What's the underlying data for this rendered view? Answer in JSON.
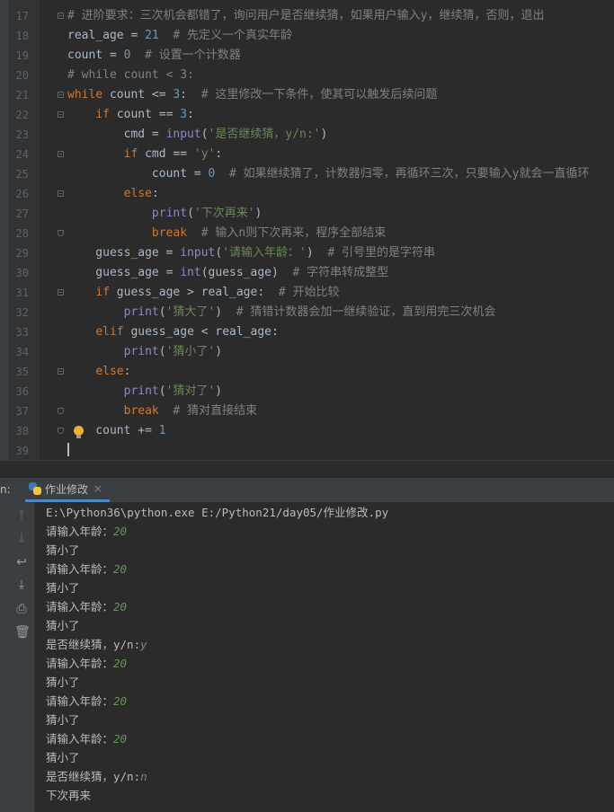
{
  "editor": {
    "lines": [
      {
        "n": "17",
        "fold": "open",
        "tokens": [
          {
            "t": "# 进阶要求：三次机会都错了，询问用户是否继续猜，如果用户输入y，继续猜，否则，退出",
            "c": "cm"
          }
        ]
      },
      {
        "n": "18",
        "tokens": [
          {
            "t": "real_age = "
          },
          {
            "t": "21",
            "c": "num"
          },
          {
            "t": "  "
          },
          {
            "t": "# 先定义一个真实年龄",
            "c": "cm"
          }
        ]
      },
      {
        "n": "19",
        "tokens": [
          {
            "t": "count = "
          },
          {
            "t": "0",
            "c": "num"
          },
          {
            "t": "  "
          },
          {
            "t": "# 设置一个计数器",
            "c": "cm"
          }
        ]
      },
      {
        "n": "20",
        "tokens": [
          {
            "t": "# while count < 3:",
            "c": "cm"
          }
        ]
      },
      {
        "n": "21",
        "fold": "open",
        "tokens": [
          {
            "t": "while",
            "c": "kw"
          },
          {
            "t": " count <= "
          },
          {
            "t": "3",
            "c": "num"
          },
          {
            "t": ":  "
          },
          {
            "t": "# 这里修改一下条件，使其可以触发后续问题",
            "c": "cm"
          }
        ]
      },
      {
        "n": "22",
        "fold": "open",
        "tokens": [
          {
            "t": "    "
          },
          {
            "t": "if",
            "c": "kw"
          },
          {
            "t": " count == "
          },
          {
            "t": "3",
            "c": "num"
          },
          {
            "t": ":"
          }
        ]
      },
      {
        "n": "23",
        "tokens": [
          {
            "t": "        cmd = "
          },
          {
            "t": "input",
            "c": "bi"
          },
          {
            "t": "("
          },
          {
            "t": "'是否继续猜，y/n:'",
            "c": "str"
          },
          {
            "t": ")"
          }
        ]
      },
      {
        "n": "24",
        "fold": "open",
        "tokens": [
          {
            "t": "        "
          },
          {
            "t": "if",
            "c": "kw"
          },
          {
            "t": " cmd == "
          },
          {
            "t": "'y'",
            "c": "str"
          },
          {
            "t": ":"
          }
        ]
      },
      {
        "n": "25",
        "tokens": [
          {
            "t": "            count = "
          },
          {
            "t": "0",
            "c": "num"
          },
          {
            "t": "  "
          },
          {
            "t": "# 如果继续猜了，计数器归零，再循环三次，只要输入y就会一直循环",
            "c": "cm"
          }
        ]
      },
      {
        "n": "26",
        "fold": "open",
        "tokens": [
          {
            "t": "        "
          },
          {
            "t": "else",
            "c": "kw"
          },
          {
            "t": ":"
          }
        ]
      },
      {
        "n": "27",
        "tokens": [
          {
            "t": "            "
          },
          {
            "t": "print",
            "c": "bi"
          },
          {
            "t": "("
          },
          {
            "t": "'下次再来'",
            "c": "str"
          },
          {
            "t": ")"
          }
        ]
      },
      {
        "n": "28",
        "fold": "end",
        "tokens": [
          {
            "t": "            "
          },
          {
            "t": "break",
            "c": "kw"
          },
          {
            "t": "  "
          },
          {
            "t": "# 输入n则下次再来，程序全部结束",
            "c": "cm"
          }
        ]
      },
      {
        "n": "29",
        "tokens": [
          {
            "t": "    guess_age = "
          },
          {
            "t": "input",
            "c": "bi"
          },
          {
            "t": "("
          },
          {
            "t": "'请输入年龄：'",
            "c": "str"
          },
          {
            "t": ")  "
          },
          {
            "t": "# 引号里的是字符串",
            "c": "cm"
          }
        ]
      },
      {
        "n": "30",
        "tokens": [
          {
            "t": "    guess_age = "
          },
          {
            "t": "int",
            "c": "bi"
          },
          {
            "t": "(guess_age)  "
          },
          {
            "t": "# 字符串转成整型",
            "c": "cm"
          }
        ]
      },
      {
        "n": "31",
        "fold": "open",
        "tokens": [
          {
            "t": "    "
          },
          {
            "t": "if",
            "c": "kw"
          },
          {
            "t": " guess_age > real_age:  "
          },
          {
            "t": "# 开始比较",
            "c": "cm"
          }
        ]
      },
      {
        "n": "32",
        "tokens": [
          {
            "t": "        "
          },
          {
            "t": "print",
            "c": "bi"
          },
          {
            "t": "("
          },
          {
            "t": "'猜大了'",
            "c": "str"
          },
          {
            "t": ")  "
          },
          {
            "t": "# 猜错计数器会加一继续验证，直到用完三次机会",
            "c": "cm"
          }
        ]
      },
      {
        "n": "33",
        "tokens": [
          {
            "t": "    "
          },
          {
            "t": "elif",
            "c": "kw"
          },
          {
            "t": " guess_age < real_age:"
          }
        ]
      },
      {
        "n": "34",
        "tokens": [
          {
            "t": "        "
          },
          {
            "t": "print",
            "c": "bi"
          },
          {
            "t": "("
          },
          {
            "t": "'猜小了'",
            "c": "str"
          },
          {
            "t": ")"
          }
        ]
      },
      {
        "n": "35",
        "fold": "open",
        "tokens": [
          {
            "t": "    "
          },
          {
            "t": "else",
            "c": "kw"
          },
          {
            "t": ":"
          }
        ]
      },
      {
        "n": "36",
        "tokens": [
          {
            "t": "        "
          },
          {
            "t": "print",
            "c": "bi"
          },
          {
            "t": "("
          },
          {
            "t": "'猜对了'",
            "c": "str"
          },
          {
            "t": ")"
          }
        ]
      },
      {
        "n": "37",
        "fold": "end",
        "tokens": [
          {
            "t": "        "
          },
          {
            "t": "break",
            "c": "kw"
          },
          {
            "t": "  "
          },
          {
            "t": "# 猜对直接结束",
            "c": "cm"
          }
        ]
      },
      {
        "n": "38",
        "fold": "end",
        "tokens": [
          {
            "t": "    count += "
          },
          {
            "t": "1",
            "c": "num"
          }
        ]
      },
      {
        "n": "39",
        "tokens": []
      }
    ]
  },
  "run": {
    "label": "n:",
    "tab_label": "作业修改",
    "close": "×"
  },
  "console": {
    "lines": [
      {
        "text": "E:\\Python36\\python.exe E:/Python21/day05/作业修改.py"
      },
      {
        "text": "请输入年龄：",
        "input": "20"
      },
      {
        "text": "猜小了"
      },
      {
        "text": "请输入年龄：",
        "input": "20"
      },
      {
        "text": "猜小了"
      },
      {
        "text": "请输入年龄：",
        "input": "20"
      },
      {
        "text": "猜小了"
      },
      {
        "text": "是否继续猜，y/n:",
        "input": "y"
      },
      {
        "text": "请输入年龄：",
        "input": "20"
      },
      {
        "text": "猜小了"
      },
      {
        "text": "请输入年龄：",
        "input": "20"
      },
      {
        "text": "猜小了"
      },
      {
        "text": "请输入年龄：",
        "input": "20"
      },
      {
        "text": "猜小了"
      },
      {
        "text": "是否继续猜，y/n:",
        "input": "n"
      },
      {
        "text": "下次再来"
      }
    ]
  },
  "toolbar": {
    "icons": [
      "up-arrow-icon",
      "down-arrow-icon",
      "soft-wrap-icon",
      "scroll-to-end-icon",
      "print-icon",
      "trash-icon"
    ],
    "glyphs": [
      "↑",
      "↓",
      "↩",
      "⤓",
      "⎙",
      "🗑"
    ]
  }
}
